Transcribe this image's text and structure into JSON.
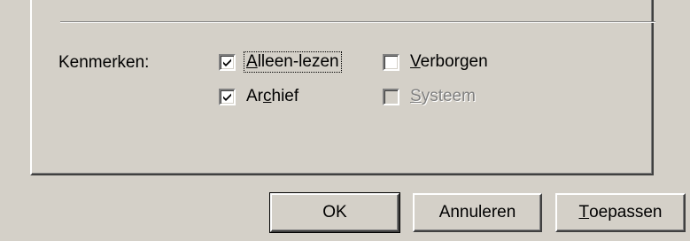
{
  "attributes": {
    "label": "Kenmerken:",
    "checkboxes": [
      {
        "pre": "",
        "accel": "A",
        "post": "lleen-lezen",
        "checked": true,
        "disabled": false,
        "focused": true
      },
      {
        "pre": "",
        "accel": "V",
        "post": "erborgen",
        "checked": false,
        "disabled": false,
        "focused": false
      },
      {
        "pre": "Ar",
        "accel": "c",
        "post": "hief",
        "checked": true,
        "disabled": false,
        "focused": false
      },
      {
        "pre": "",
        "accel": "S",
        "post": "ysteem",
        "checked": false,
        "disabled": true,
        "focused": false
      }
    ]
  },
  "buttons": {
    "ok": {
      "label": "OK"
    },
    "cancel": {
      "label": "Annuleren"
    },
    "apply": {
      "pre": "",
      "accel": "T",
      "post": "oepassen"
    }
  },
  "colors": {
    "face": "#d4d0c8",
    "highlight": "#ffffff",
    "shadow": "#808080",
    "dark_shadow": "#404040",
    "disabled_text": "#808080"
  }
}
